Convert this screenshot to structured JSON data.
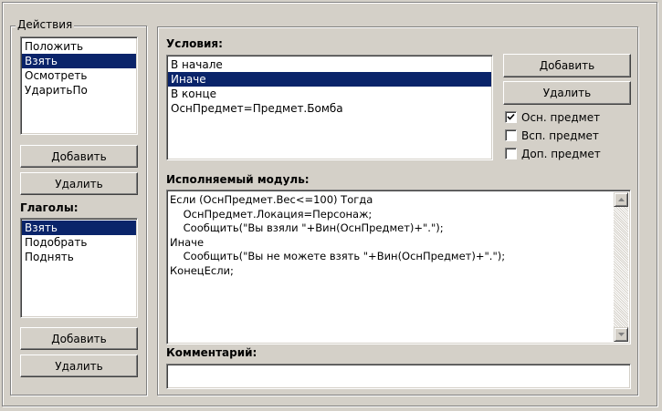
{
  "actions": {
    "group_title": "Действия",
    "items": [
      {
        "label": "Положить",
        "selected": false
      },
      {
        "label": "Взять",
        "selected": true
      },
      {
        "label": "Осмотреть",
        "selected": false
      },
      {
        "label": "УдаритьПо",
        "selected": false
      }
    ],
    "add_label": "Добавить",
    "delete_label": "Удалить"
  },
  "verbs": {
    "title": "Глаголы:",
    "items": [
      {
        "label": "Взять",
        "selected": true
      },
      {
        "label": "Подобрать",
        "selected": false
      },
      {
        "label": "Поднять",
        "selected": false
      }
    ],
    "add_label": "Добавить",
    "delete_label": "Удалить"
  },
  "conditions": {
    "title": "Условия:",
    "items": [
      {
        "label": "В начале",
        "selected": false
      },
      {
        "label": "Иначе",
        "selected": true
      },
      {
        "label": "В конце",
        "selected": false
      },
      {
        "label": "ОснПредмет=Предмет.Бомба",
        "selected": false
      }
    ],
    "add_label": "Добавить",
    "delete_label": "Удалить",
    "checkboxes": [
      {
        "label": "Осн. предмет",
        "checked": true
      },
      {
        "label": "Всп. предмет",
        "checked": false
      },
      {
        "label": "Доп. предмет",
        "checked": false
      }
    ]
  },
  "module": {
    "title": "Исполняемый модуль:",
    "lines": [
      "Если (ОснПредмет.Вес<=100) Тогда",
      "    ОснПредмет.Локация=Персонаж;",
      "    Сообщить(\"Вы взяли \"+Вин(ОснПредмет)+\".\");",
      "Иначе",
      "    Сообщить(\"Вы не можете взять \"+Вин(ОснПредмет)+\".\");",
      "КонецЕсли;"
    ]
  },
  "comment": {
    "title": "Комментарий:",
    "value": ""
  },
  "icons": {
    "scroll_up": "scroll-up-arrow-icon",
    "scroll_down": "scroll-down-arrow-icon",
    "check": "check-mark-icon"
  },
  "colors": {
    "face": "#d4d0c8",
    "selection": "#0a246a"
  }
}
